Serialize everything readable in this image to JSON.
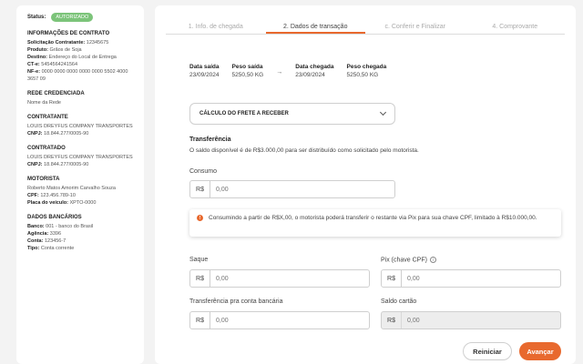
{
  "sidebar": {
    "status_label": "Status:",
    "status_badge": "AUTORIZADO",
    "contract": {
      "title": "INFORMAÇÕES DE CONTRATO",
      "lines": [
        {
          "key": "Solicitação Contratante:",
          "value": "12345675"
        },
        {
          "key": "Produto:",
          "value": "Grãos de Soja"
        },
        {
          "key": "Destino:",
          "value": "Endereço do Local de Entrega"
        },
        {
          "key": "CT-e:",
          "value": "5454564241564"
        },
        {
          "key": "NF-e:",
          "value": "0000 0000 0000 0000 0000 5502 4000 3657 09"
        }
      ]
    },
    "network": {
      "title": "REDE CREDENCIADA",
      "value": "Nome da Rede"
    },
    "contractor": {
      "title": "CONTRATANTE",
      "name": "LOUIS DREYFUS COMPANY TRANSPORTES",
      "cnpj_key": "CNPJ:",
      "cnpj": "18.844.277/0005-90"
    },
    "contracted": {
      "title": "CONTRATADO",
      "name": "LOUIS DREYFUS COMPANY TRANSPORTES",
      "cnpj_key": "CNPJ:",
      "cnpj": "18.844.277/0005-90"
    },
    "driver": {
      "title": "MOTORISTA",
      "name": "Roberto Matos Amorim Carvalho Souza",
      "cpf_key": "CPF:",
      "cpf": "123.456.789-10",
      "plate_key": "Placa do veículo:",
      "plate": "XPTO-0000"
    },
    "bank": {
      "title": "DADOS BANCÁRIOS",
      "lines": [
        {
          "key": "Banco:",
          "value": "001 - banco do Brasil"
        },
        {
          "key": "Agência:",
          "value": "3396"
        },
        {
          "key": "Conta:",
          "value": "123456-7"
        },
        {
          "key": "Tipo:",
          "value": "Conta corrente"
        }
      ]
    }
  },
  "stepper": {
    "steps": [
      "1. Info. de chegada",
      "2. Dados de transação",
      "c. Conferir e Finalizar",
      "4. Comprovante"
    ],
    "active_index": 1
  },
  "transit": {
    "exit_date_label": "Data saída",
    "exit_date": "23/09/2024",
    "exit_weight_label": "Peso saída",
    "exit_weight": "5250,50 KG",
    "arrow": "→",
    "arrival_date_label": "Data chegada",
    "arrival_date": "23/09/2024",
    "arrival_weight_label": "Peso chegada",
    "arrival_weight": "5250,50 KG"
  },
  "freight_select": {
    "value": "CÁLCULO DO FRETE A RECEBER"
  },
  "transfer": {
    "title": "Transferência",
    "description": "O saldo disponível é de R$3.000,00 para ser distribuído como solicitado pelo motorista."
  },
  "fields": {
    "currency_prefix": "R$",
    "consumo": {
      "label": "Consumo",
      "placeholder": "0,00"
    },
    "saque": {
      "label": "Saque",
      "placeholder": "0,00"
    },
    "pix": {
      "label": "Pix (chave CPF)",
      "help": "i",
      "placeholder": "0,00"
    },
    "transfer_account": {
      "label": "Transferência pra conta bancária",
      "placeholder": "0,00"
    },
    "saldo_cartao": {
      "label": "Saldo cartão",
      "placeholder": "0,00"
    }
  },
  "info_box": {
    "icon": "!",
    "text": "Consumindo a partir de R$X,00, o motorista poderá transferir o restante via Pix para sua chave CPF, limitado à R$10.000,00."
  },
  "buttons": {
    "reset": "Reiniciar",
    "next": "Avançar"
  },
  "colors": {
    "accent": "#e8692e",
    "status_green": "#7cc47a"
  }
}
